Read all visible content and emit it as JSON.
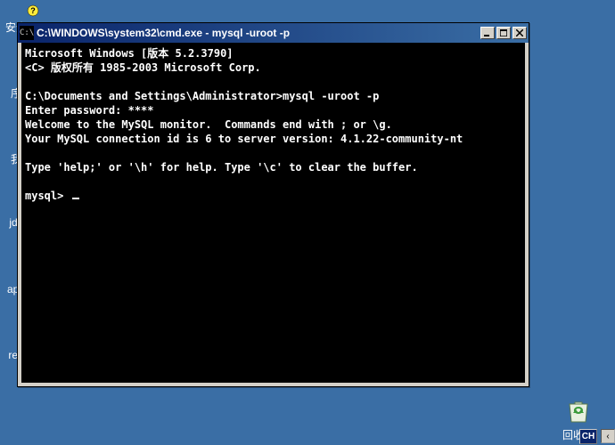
{
  "desktop": {
    "partial_labels": {
      "item1": "安全",
      "item2": "序",
      "item3": "我",
      "item4": "jdk",
      "item5": "apa",
      "item6": "red"
    },
    "help_tooltip": "?"
  },
  "cmd_window": {
    "title": "C:\\WINDOWS\\system32\\cmd.exe - mysql -uroot -p",
    "icon_text": "C:\\"
  },
  "console": {
    "line1": "Microsoft Windows [版本 5.2.3790]",
    "line2": "<C> 版权所有 1985-2003 Microsoft Corp.",
    "line3": "",
    "line4": "C:\\Documents and Settings\\Administrator>mysql -uroot -p",
    "line5": "Enter password: ****",
    "line6": "Welcome to the MySQL monitor.  Commands end with ; or \\g.",
    "line7": "Your MySQL connection id is 6 to server version: 4.1.22-community-nt",
    "line8": "",
    "line9": "Type 'help;' or '\\h' for help. Type '\\c' to clear the buffer.",
    "line10": "",
    "line11_prompt": "mysql> "
  },
  "recycle_bin": {
    "label": "回收站"
  },
  "taskbar": {
    "ime": "CH",
    "tray": "‹"
  }
}
